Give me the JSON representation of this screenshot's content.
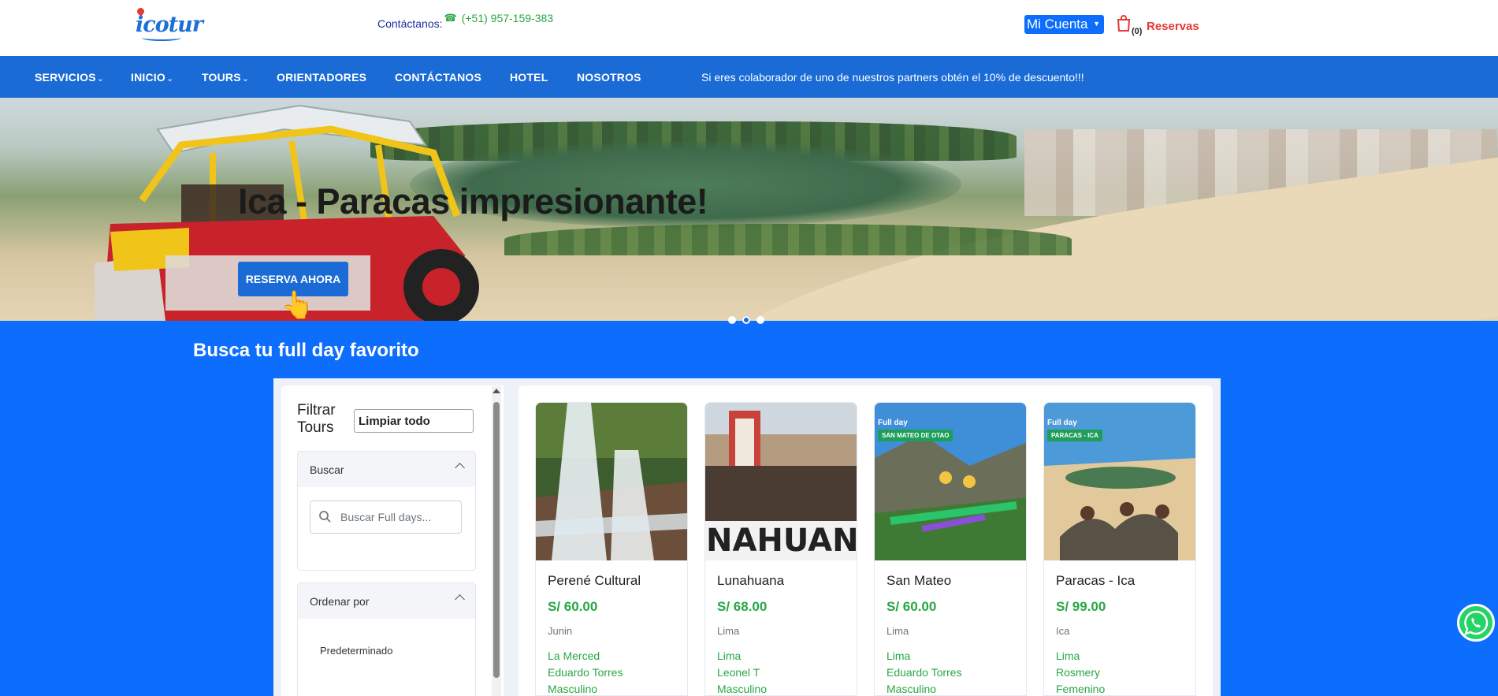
{
  "header": {
    "logo_text": "icotur",
    "contact_label": "Contáctanos:",
    "contact_phone": "(+51) 957-159-383",
    "account_label": "Mi Cuenta",
    "cart_count": "(0)",
    "cart_label": "Reservas"
  },
  "nav": {
    "items": [
      {
        "label": "SERVICIOS",
        "chevron": true
      },
      {
        "label": "INICIO",
        "chevron": true
      },
      {
        "label": "TOURS",
        "chevron": true
      },
      {
        "label": "ORIENTADORES",
        "chevron": false
      },
      {
        "label": "CONTÁCTANOS",
        "chevron": false
      },
      {
        "label": "HOTEL",
        "chevron": false
      },
      {
        "label": "NOSOTROS",
        "chevron": false
      }
    ],
    "chevron_glyph": "⌄",
    "promo": "Si eres colaborador de uno de nuestros partners obtén el 10% de descuento!!!"
  },
  "hero": {
    "title": "Ica - Paracas impresionante!",
    "button_label": "RESERVA AHORA",
    "slide_count": 3,
    "active_slide": 2
  },
  "search_section": {
    "title": "Busca tu full day favorito"
  },
  "filters": {
    "title": "Filtrar Tours",
    "clear_label": "Limpiar todo",
    "search_heading": "Buscar",
    "search_placeholder": "Buscar Full days...",
    "order_heading": "Ordenar por",
    "order_options": [
      "Predeterminado"
    ]
  },
  "cards": [
    {
      "name": "Perené Cultural",
      "price": "S/ 60.00",
      "region": "Junin",
      "lines": [
        "La Merced",
        "Eduardo Torres",
        "Masculino"
      ],
      "badge_top": "",
      "badge_sub": ""
    },
    {
      "name": "Lunahuana",
      "price": "S/ 68.00",
      "region": "Lima",
      "lines": [
        "Lima",
        "Leonel T",
        "Masculino"
      ],
      "badge_top": "",
      "badge_sub": "",
      "image_text": "UNAHUANA"
    },
    {
      "name": "San Mateo",
      "price": "S/ 60.00",
      "region": "Lima",
      "lines": [
        "Lima",
        "Eduardo Torres",
        "Masculino"
      ],
      "badge_top": "Full day",
      "badge_sub": "SAN MATEO DE OTAO"
    },
    {
      "name": "Paracas - Ica",
      "price": "S/ 99.00",
      "region": "Ica",
      "lines": [
        "Lima",
        "Rosmery",
        "Femenino"
      ],
      "badge_top": "Full day",
      "badge_sub": "PARACAS - ICA"
    }
  ],
  "colors": {
    "brand_blue": "#0d6efd",
    "nav_blue": "#1a6bd6",
    "price_green": "#28a745",
    "cart_red": "#e53935"
  }
}
